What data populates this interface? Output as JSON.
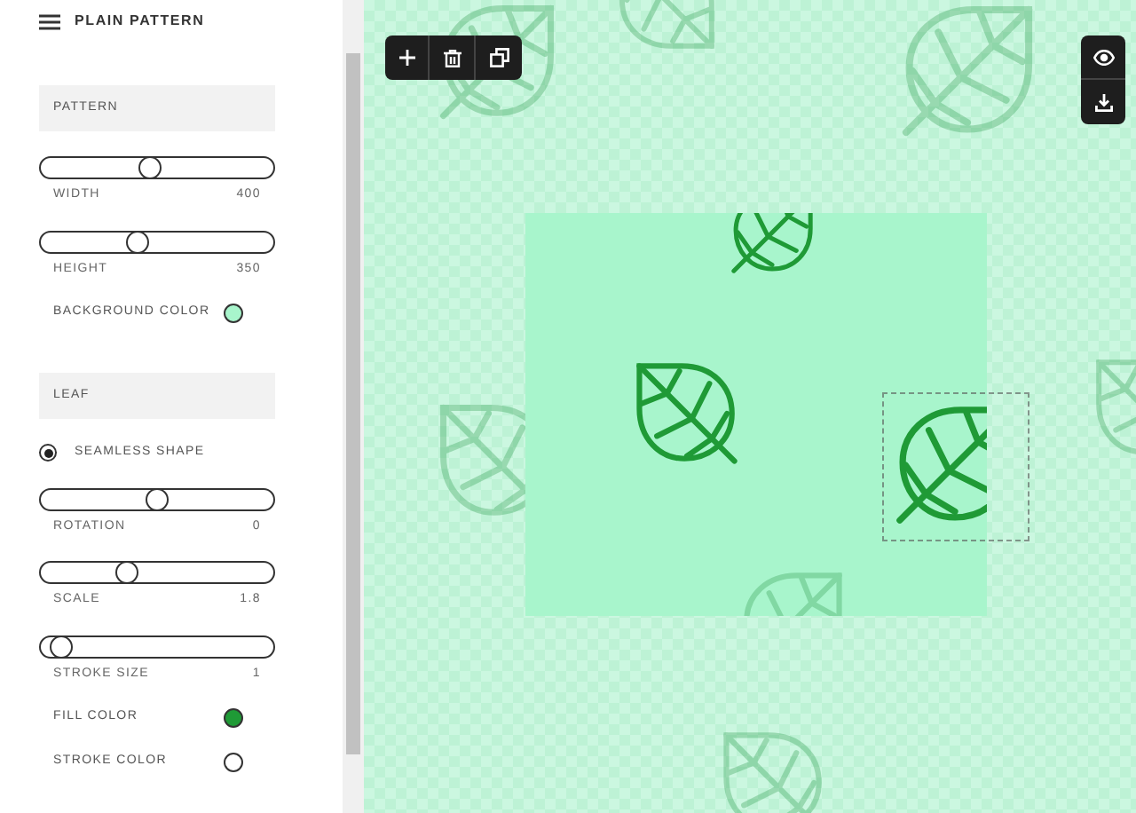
{
  "title": "PLAIN PATTERN",
  "controls": [
    {
      "kind": "header",
      "label": "PATTERN"
    },
    {
      "kind": "slider",
      "label": "WIDTH",
      "value": "400",
      "level": 0.47
    },
    {
      "kind": "slider",
      "label": "HEIGHT",
      "value": "350",
      "level": 0.41
    },
    {
      "kind": "color",
      "label": "BACKGROUND COLOR",
      "color": "#a8f5cc"
    },
    {
      "kind": "header",
      "label": "LEAF"
    },
    {
      "kind": "radio",
      "label": "SEAMLESS SHAPE",
      "selected": true
    },
    {
      "kind": "slider",
      "label": "ROTATION",
      "value": "0",
      "level": 0.5
    },
    {
      "kind": "slider",
      "label": "SCALE",
      "value": "1.8",
      "level": 0.36
    },
    {
      "kind": "slider",
      "label": "STROKE SIZE",
      "value": "1",
      "level": 0.04
    },
    {
      "kind": "color",
      "label": "FILL COLOR",
      "color": "#1f9a36"
    },
    {
      "kind": "color",
      "label": "STROKE COLOR",
      "color": "#ffffff"
    }
  ]
}
